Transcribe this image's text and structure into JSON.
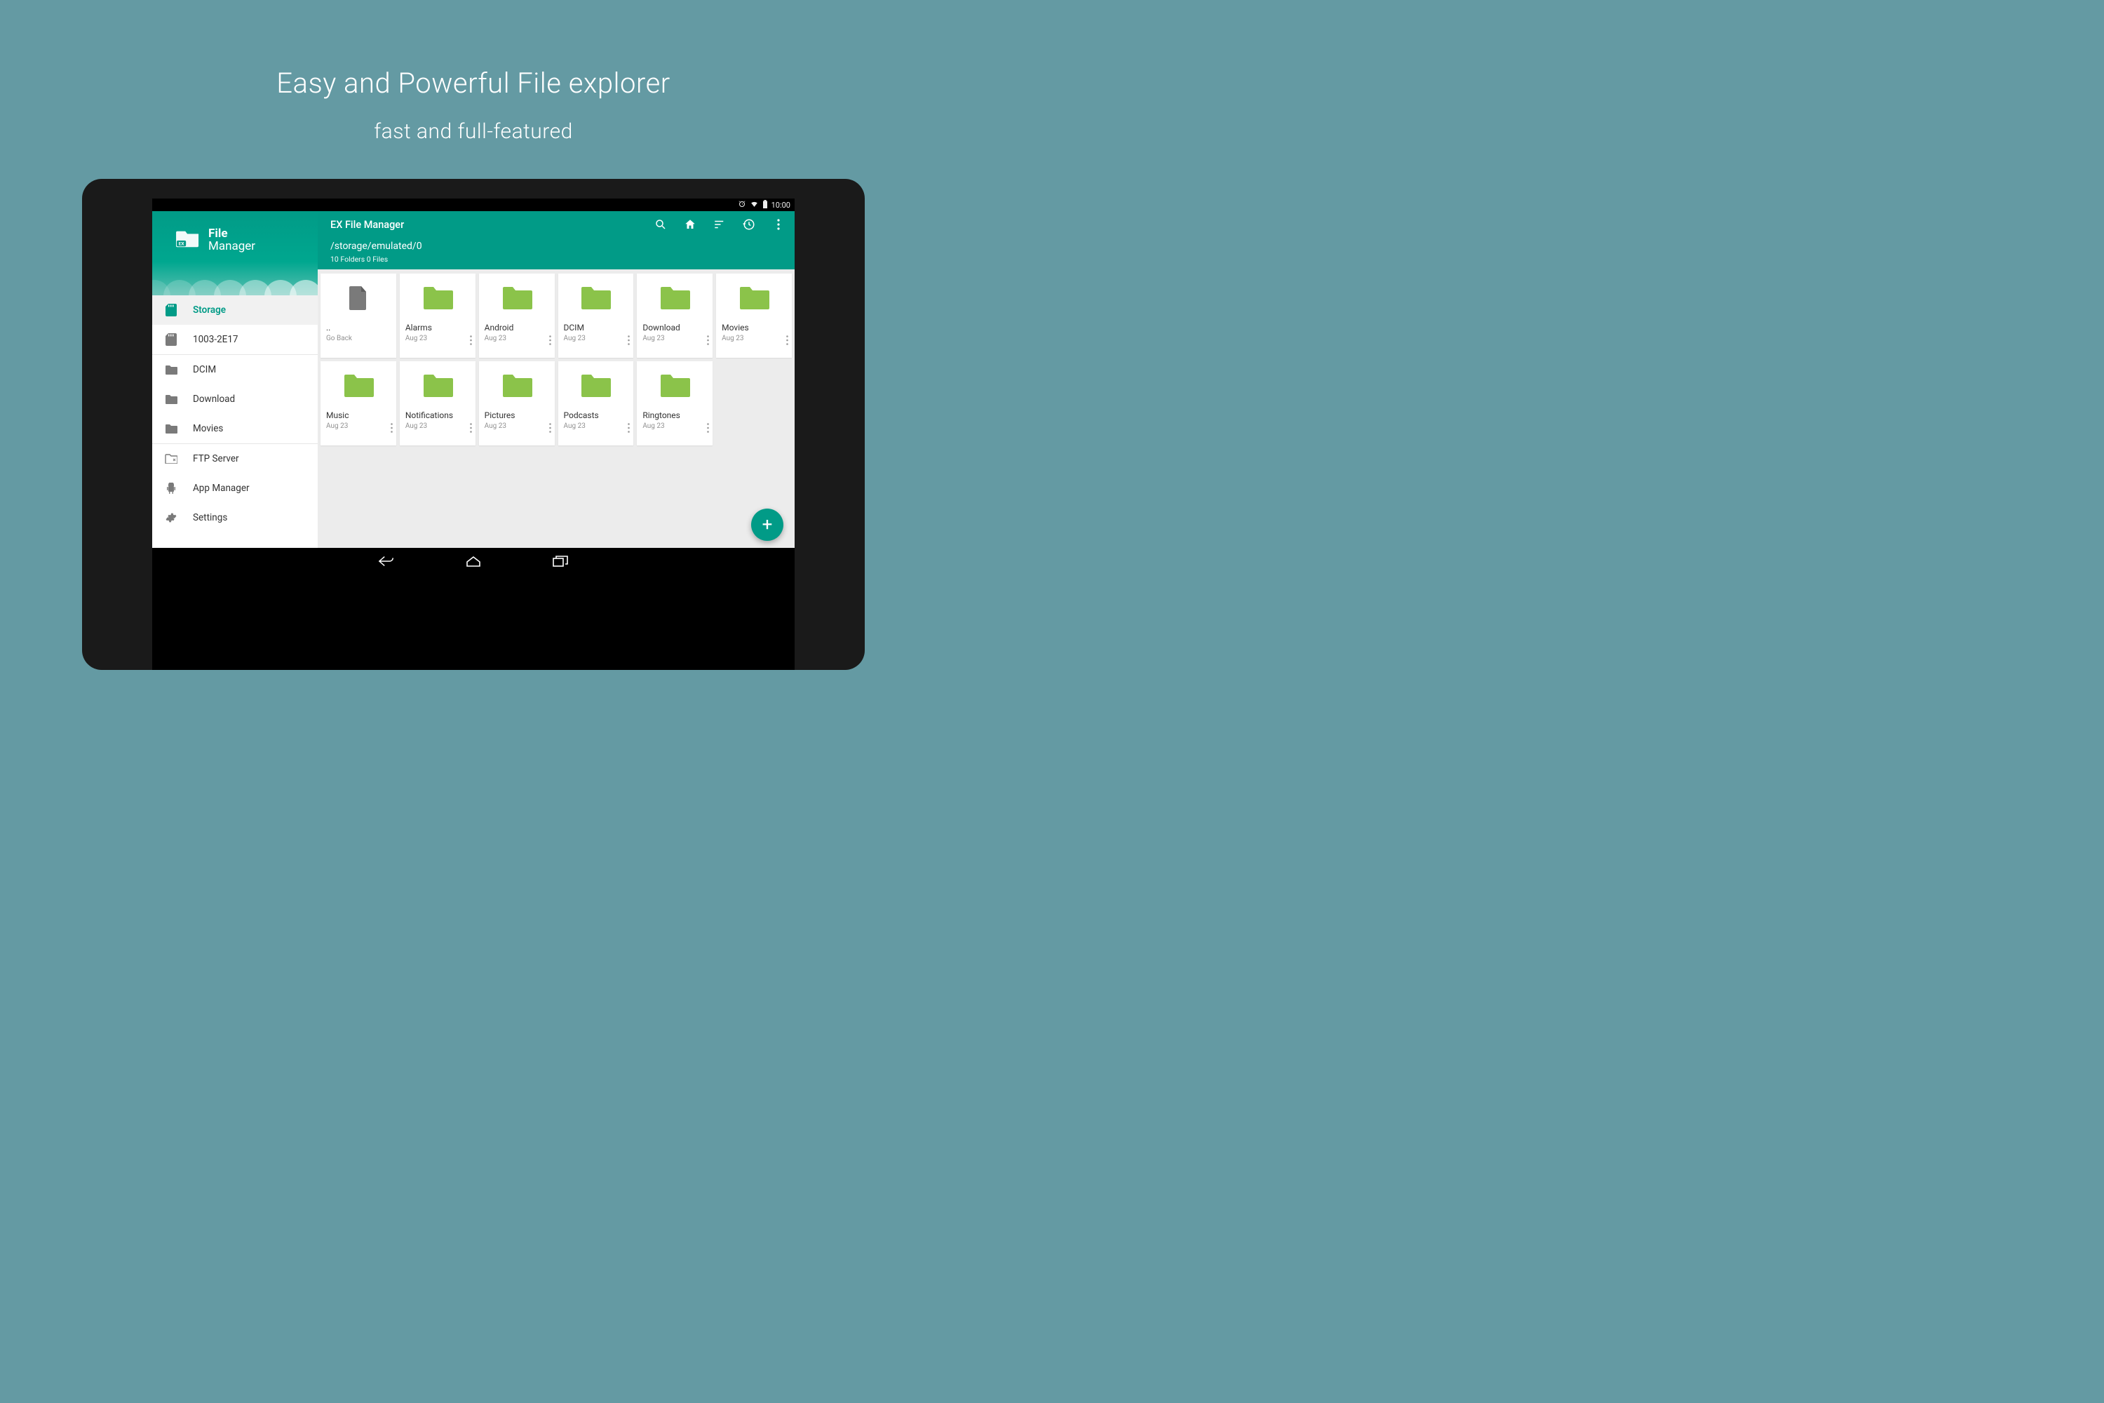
{
  "promo": {
    "title": "Easy and Powerful File explorer",
    "subtitle": "fast and full-featured"
  },
  "status": {
    "time": "10:00"
  },
  "brand": {
    "line1": "File",
    "line2": "Manager"
  },
  "sidebar": {
    "items": [
      {
        "label": "Storage",
        "icon": "sd",
        "active": true
      },
      {
        "label": "1003-2E17",
        "icon": "sd"
      },
      {
        "label": "DCIM",
        "icon": "folder"
      },
      {
        "label": "Download",
        "icon": "folder"
      },
      {
        "label": "Movies",
        "icon": "folder"
      },
      {
        "label": "FTP Server",
        "icon": "ftp"
      },
      {
        "label": "App Manager",
        "icon": "android"
      },
      {
        "label": "Settings",
        "icon": "gear"
      }
    ]
  },
  "toolbar": {
    "title": "EX File Manager",
    "path": "/storage/emulated/0",
    "count": "10 Folders 0 Files"
  },
  "grid": {
    "items": [
      {
        "name": "..",
        "sub": "Go Back",
        "icon": "file"
      },
      {
        "name": "Alarms",
        "sub": "Aug 23",
        "icon": "folder"
      },
      {
        "name": "Android",
        "sub": "Aug 23",
        "icon": "folder"
      },
      {
        "name": "DCIM",
        "sub": "Aug 23",
        "icon": "folder"
      },
      {
        "name": "Download",
        "sub": "Aug 23",
        "icon": "folder"
      },
      {
        "name": "Movies",
        "sub": "Aug 23",
        "icon": "folder"
      },
      {
        "name": "Music",
        "sub": "Aug 23",
        "icon": "folder"
      },
      {
        "name": "Notifications",
        "sub": "Aug 23",
        "icon": "folder"
      },
      {
        "name": "Pictures",
        "sub": "Aug 23",
        "icon": "folder"
      },
      {
        "name": "Podcasts",
        "sub": "Aug 23",
        "icon": "folder"
      },
      {
        "name": "Ringtones",
        "sub": "Aug 23",
        "icon": "folder"
      }
    ]
  },
  "fab": {
    "label": "+"
  }
}
